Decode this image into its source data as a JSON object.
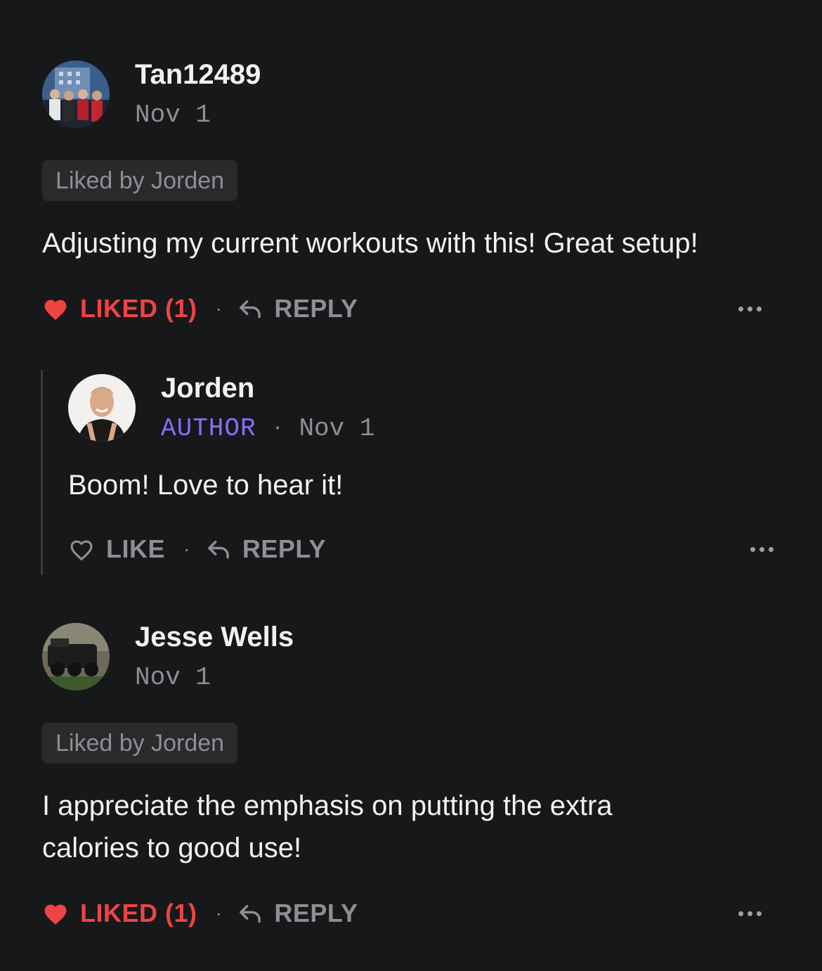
{
  "comments": [
    {
      "username": "Tan12489",
      "date": "Nov 1",
      "liked_by": "Liked by Jorden",
      "text": "Adjusting my current workouts with this! Great setup!",
      "like_label": "LIKED (1)",
      "reply_label": "REPLY",
      "liked": true
    },
    {
      "username": "Jesse Wells",
      "date": "Nov 1",
      "liked_by": "Liked by Jorden",
      "text": "I appreciate the emphasis on putting the extra calories to good use!",
      "like_label": "LIKED (1)",
      "reply_label": "REPLY",
      "liked": true
    }
  ],
  "reply": {
    "username": "Jorden",
    "author_tag": "AUTHOR",
    "date": "Nov 1",
    "text": "Boom! Love to hear it!",
    "like_label": "LIKE",
    "reply_label": "REPLY",
    "liked": false
  },
  "separator": "·",
  "colors": {
    "background": "#17181a",
    "liked_red": "#ef4444",
    "author_purple": "#8b6cf7",
    "muted_gray": "#8e8e93",
    "pill_bg": "#2a2a2d"
  },
  "icons": {
    "liked": "heart-filled-icon",
    "like": "heart-outline-icon",
    "reply": "reply-arrow-icon",
    "more": "more-dots-icon"
  }
}
